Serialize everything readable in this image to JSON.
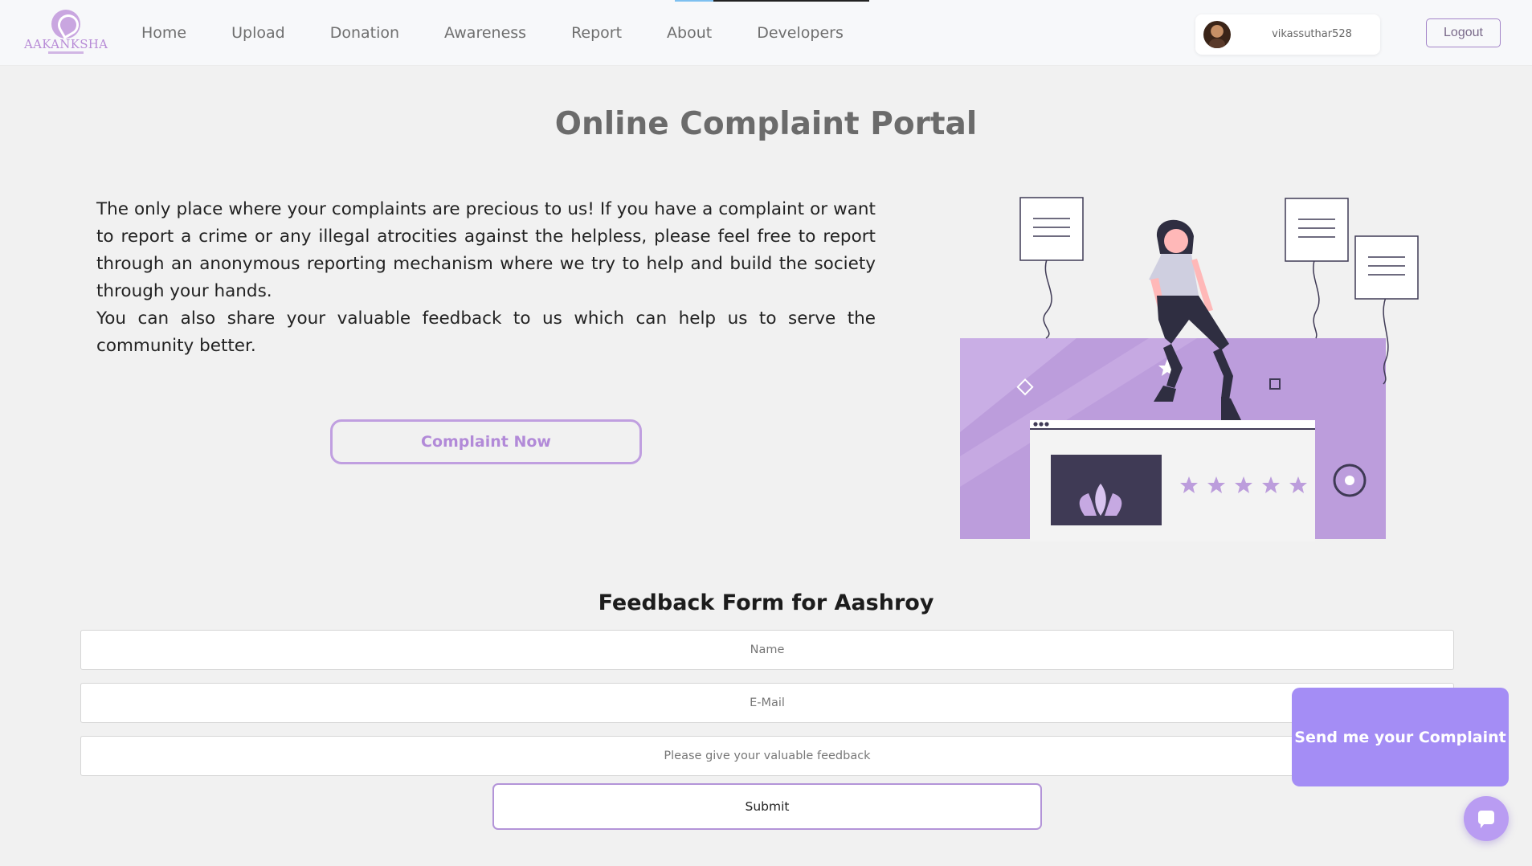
{
  "brand": {
    "logo_text": "AAKANKSHA"
  },
  "nav": {
    "links": [
      "Home",
      "Upload",
      "Donation",
      "Awareness",
      "Report",
      "About",
      "Developers"
    ]
  },
  "user": {
    "username": "vikassuthar528",
    "logout_label": "Logout"
  },
  "hero": {
    "title": "Online Complaint Portal",
    "paragraph_1": "The only place where your complaints are precious to us! If you have a complaint or want to report a crime or any illegal atrocities against the helpless, please feel free to report through an anonymous reporting mechanism where we try to help and build the society through your hands.",
    "paragraph_2": "You can also share your valuable feedback to us which can help us to serve the community better.",
    "cta_label": "Complaint Now"
  },
  "feedback": {
    "title": "Feedback Form for Aashroy",
    "name_placeholder": "Name",
    "email_placeholder": "E-Mail",
    "feedback_placeholder": "Please give your valuable feedback",
    "submit_label": "Submit"
  },
  "floating": {
    "send_complaint_label": "Send me your Complaint"
  },
  "icons": {
    "chat": "chat-icon",
    "logo": "logo-icon"
  },
  "colors": {
    "accent": "#b28ad8",
    "panel_purple": "#b899d8",
    "floating_purple": "#a48df5"
  }
}
